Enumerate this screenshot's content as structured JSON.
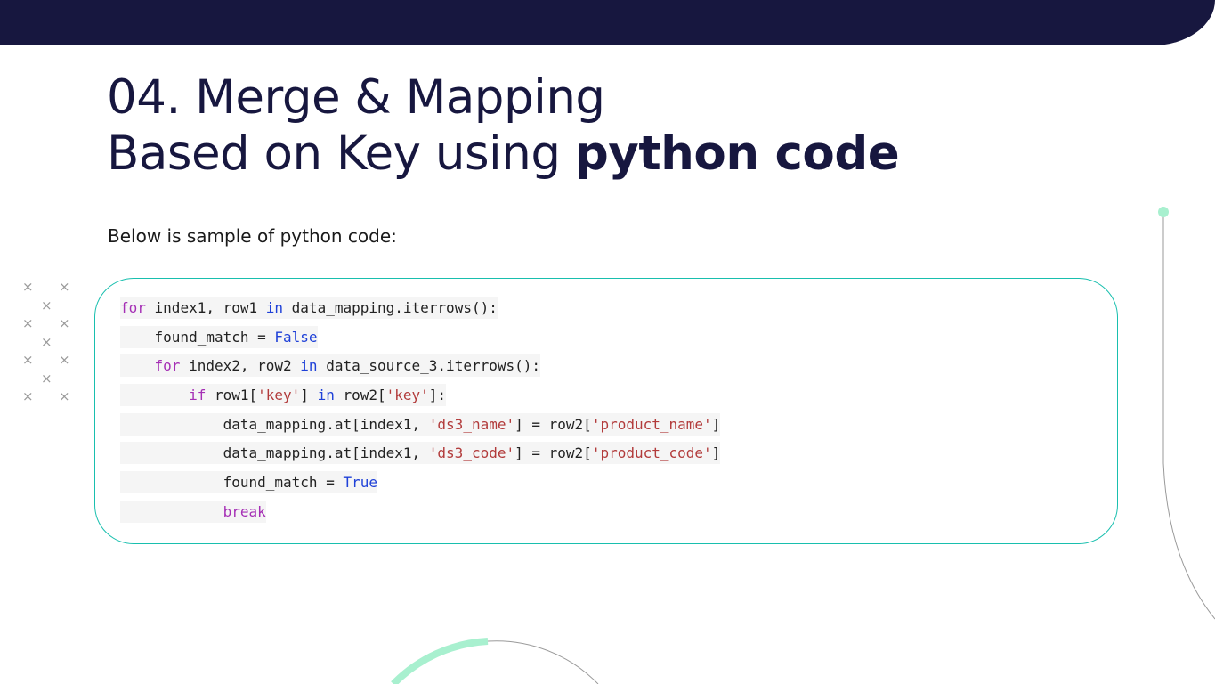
{
  "slide": {
    "title_line1": "04. Merge & Mapping",
    "title_line2_regular": "Based on Key using ",
    "title_line2_bold": "python code",
    "subtitle": "Below is sample of python code:"
  },
  "code_lines": [
    [
      {
        "t": "for",
        "c": "kw"
      },
      {
        "t": " index1, row1 ",
        "c": "tx"
      },
      {
        "t": "in",
        "c": "bi"
      },
      {
        "t": " data_mapping.iterrows():",
        "c": "tx"
      }
    ],
    [
      {
        "t": "    found_match = ",
        "c": "tx"
      },
      {
        "t": "False",
        "c": "bi"
      }
    ],
    [
      {
        "t": "    ",
        "c": "tx"
      },
      {
        "t": "for",
        "c": "kw"
      },
      {
        "t": " index2, row2 ",
        "c": "tx"
      },
      {
        "t": "in",
        "c": "bi"
      },
      {
        "t": " data_source_3.iterrows():",
        "c": "tx"
      }
    ],
    [
      {
        "t": "        ",
        "c": "tx"
      },
      {
        "t": "if",
        "c": "kw"
      },
      {
        "t": " row1[",
        "c": "tx"
      },
      {
        "t": "'key'",
        "c": "str"
      },
      {
        "t": "] ",
        "c": "tx"
      },
      {
        "t": "in",
        "c": "bi"
      },
      {
        "t": " row2[",
        "c": "tx"
      },
      {
        "t": "'key'",
        "c": "str"
      },
      {
        "t": "]:",
        "c": "tx"
      }
    ],
    [
      {
        "t": "            data_mapping.at[index1, ",
        "c": "tx"
      },
      {
        "t": "'ds3_name'",
        "c": "str"
      },
      {
        "t": "] = row2[",
        "c": "tx"
      },
      {
        "t": "'product_name'",
        "c": "str"
      },
      {
        "t": "]",
        "c": "tx"
      }
    ],
    [
      {
        "t": "            data_mapping.at[index1, ",
        "c": "tx"
      },
      {
        "t": "'ds3_code'",
        "c": "str"
      },
      {
        "t": "] = row2[",
        "c": "tx"
      },
      {
        "t": "'product_code'",
        "c": "str"
      },
      {
        "t": "]",
        "c": "tx"
      }
    ],
    [
      {
        "t": "            found_match = ",
        "c": "tx"
      },
      {
        "t": "True",
        "c": "bi"
      }
    ],
    [
      {
        "t": "            ",
        "c": "tx"
      },
      {
        "t": "break",
        "c": "kw"
      }
    ]
  ],
  "decoration": {
    "x_mark_glyph": "×",
    "colors": {
      "banner": "#17173f",
      "accent_teal": "#18bfae",
      "accent_mint": "#a8f0cf",
      "line_gray": "#9a9a9a"
    }
  }
}
